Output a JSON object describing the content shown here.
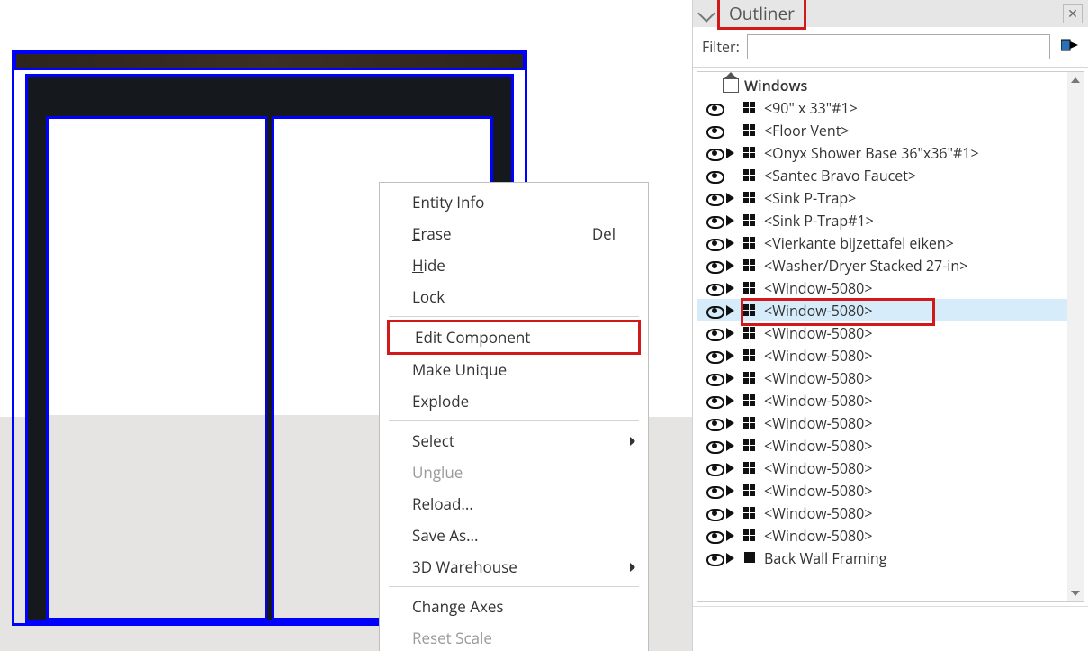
{
  "panel": {
    "title": "Outliner",
    "filter_label": "Filter:",
    "filter_value": ""
  },
  "context_menu": {
    "items": [
      {
        "label": "Entity Info",
        "type": "item"
      },
      {
        "label": "Erase",
        "shortcut": "Del",
        "type": "item",
        "underline": true
      },
      {
        "label": "Hide",
        "type": "item",
        "underline": true
      },
      {
        "label": "Lock",
        "type": "item"
      },
      {
        "type": "sep"
      },
      {
        "label": "Edit Component",
        "type": "item",
        "highlight": true
      },
      {
        "label": "Make Unique",
        "type": "item"
      },
      {
        "label": "Explode",
        "type": "item"
      },
      {
        "type": "sep"
      },
      {
        "label": "Select",
        "type": "submenu"
      },
      {
        "label": "Unglue",
        "type": "item",
        "disabled": true
      },
      {
        "label": "Reload...",
        "type": "item"
      },
      {
        "label": "Save As...",
        "type": "item"
      },
      {
        "label": "3D Warehouse",
        "type": "submenu"
      },
      {
        "type": "sep"
      },
      {
        "label": "Change Axes",
        "type": "item"
      },
      {
        "label": "Reset Scale",
        "type": "item",
        "disabled": true
      }
    ]
  },
  "outliner": {
    "root": "Windows",
    "rows": [
      {
        "name": "<90\" x 33\"#1>",
        "expandable": false
      },
      {
        "name": "<Floor Vent>",
        "expandable": false
      },
      {
        "name": "<Onyx Shower Base 36\"x36\"#1>",
        "expandable": true
      },
      {
        "name": "<Santec Bravo Faucet>",
        "expandable": false
      },
      {
        "name": "<Sink P-Trap>",
        "expandable": true
      },
      {
        "name": "<Sink P-Trap#1>",
        "expandable": true
      },
      {
        "name": "<Vierkante bijzettafel eiken>",
        "expandable": true
      },
      {
        "name": "<Washer/Dryer Stacked 27-in>",
        "expandable": true
      },
      {
        "name": "<Window-5080>",
        "expandable": true
      },
      {
        "name": "<Window-5080>",
        "expandable": true,
        "selected": true
      },
      {
        "name": "<Window-5080>",
        "expandable": true
      },
      {
        "name": "<Window-5080>",
        "expandable": true
      },
      {
        "name": "<Window-5080>",
        "expandable": true
      },
      {
        "name": "<Window-5080>",
        "expandable": true
      },
      {
        "name": "<Window-5080>",
        "expandable": true
      },
      {
        "name": "<Window-5080>",
        "expandable": true
      },
      {
        "name": "<Window-5080>",
        "expandable": true
      },
      {
        "name": "<Window-5080>",
        "expandable": true
      },
      {
        "name": "<Window-5080>",
        "expandable": true
      },
      {
        "name": "<Window-5080>",
        "expandable": true
      },
      {
        "name": "Back Wall Framing",
        "expandable": true,
        "solid": true
      }
    ]
  }
}
